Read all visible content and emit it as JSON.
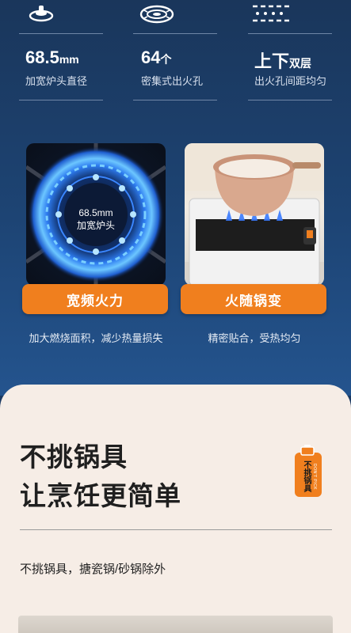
{
  "specs": [
    {
      "value": "68.5",
      "unit": "mm",
      "label": "加宽炉头直径",
      "icon": "burner-cap-icon"
    },
    {
      "value": "64",
      "unit": "个",
      "label": "密集式出火孔",
      "icon": "burner-ring-icon"
    },
    {
      "value": "上下",
      "unit": "双层",
      "label": "出火孔间距均匀",
      "icon": "flame-holes-icon"
    }
  ],
  "features": [
    {
      "overlay_text": "68.5mm\n加宽炉头",
      "title": "宽频火力",
      "caption": "加大燃烧面积，减少热量损失"
    },
    {
      "title": "火随锅变",
      "caption": "精密贴合，受热均匀"
    }
  ],
  "section2": {
    "headline_line1": "不挑锅具",
    "headline_line2": "让烹饪更简单",
    "badge_text": "不挑锅具",
    "badge_side_text": "DON'T PICK",
    "subtext": "不挑锅具，搪瓷锅/砂锅除外"
  },
  "colors": {
    "accent": "#f07f1e",
    "dark_bg": "#1d4474",
    "light_bg": "#f6ede6"
  }
}
